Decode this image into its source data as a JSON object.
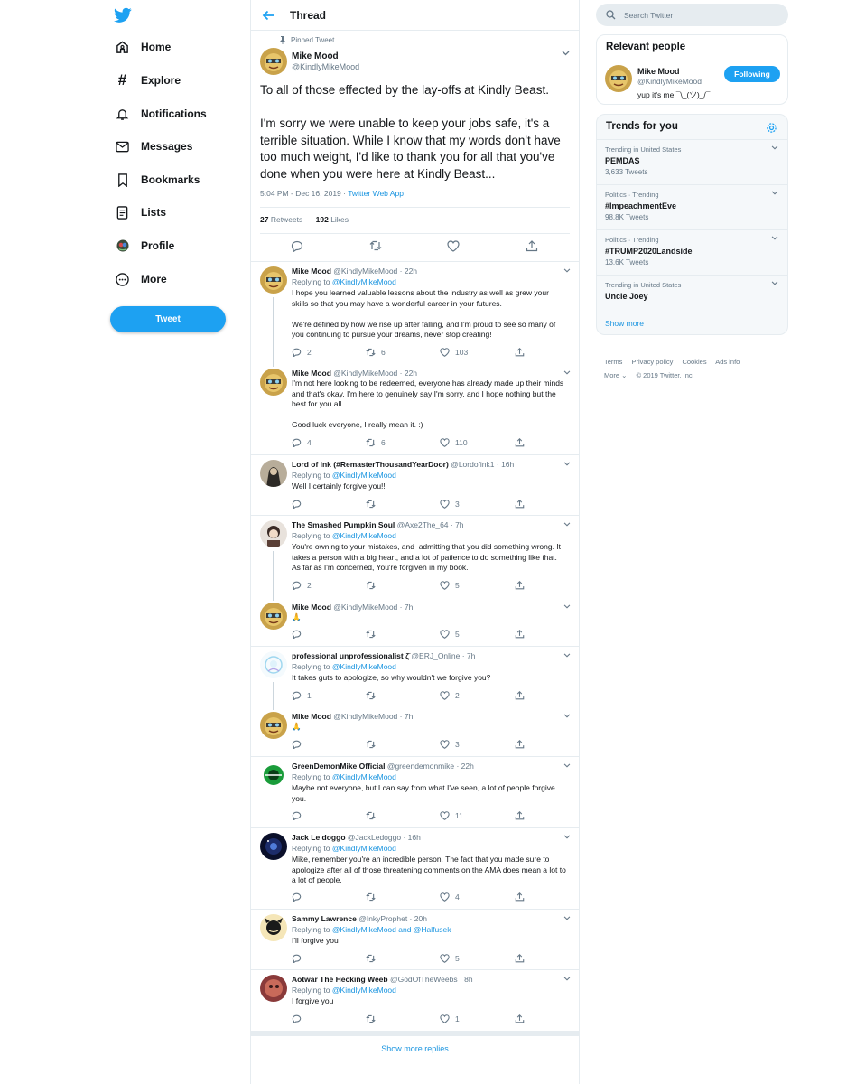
{
  "nav": {
    "items": [
      {
        "label": "Home",
        "icon": "home-icon"
      },
      {
        "label": "Explore",
        "icon": "hashtag-icon"
      },
      {
        "label": "Notifications",
        "icon": "bell-icon"
      },
      {
        "label": "Messages",
        "icon": "envelope-icon"
      },
      {
        "label": "Bookmarks",
        "icon": "bookmark-icon"
      },
      {
        "label": "Lists",
        "icon": "list-icon"
      },
      {
        "label": "Profile",
        "icon": "profile-avatar-icon"
      },
      {
        "label": "More",
        "icon": "more-dots-icon"
      }
    ],
    "tweet_button": "Tweet"
  },
  "header": {
    "title": "Thread"
  },
  "main_tweet": {
    "pinned_label": "Pinned Tweet",
    "name": "Mike Mood",
    "handle": "@KindlyMikeMood",
    "text": "To all of those effected by the lay-offs at Kindly Beast.\n\nI'm sorry we were unable to keep your jobs safe, it's a terrible situation. While I know that my words don't have too much weight, I'd like to thank you for all that you've done when you were here at Kindly Beast...",
    "time": "5:04 PM - Dec 16, 2019 · ",
    "source": "Twitter Web App",
    "retweets": "27",
    "retweets_label": " Retweets",
    "likes": "192",
    "likes_label": " Likes"
  },
  "replies": [
    {
      "name": "Mike Mood",
      "handle": "@KindlyMikeMood · 22h",
      "replying_prefix": "Replying to ",
      "replying_to": "@KindlyMikeMood",
      "text": "I hope you learned valuable lessons about the industry as well as grew your skills so that you may have a wonderful career in your futures.\n\nWe're defined by how we rise up after falling, and I'm proud to see so many of you continuing to pursue your dreams, never stop creating!",
      "replies": "2",
      "retweets": "6",
      "likes": "103"
    },
    {
      "name": "Mike Mood",
      "handle": "@KindlyMikeMood · 22h",
      "text": "I'm not here looking to be redeemed, everyone has already made up their minds and that's okay, I'm here to genuinely say I'm sorry, and I hope nothing but the best for you all.\n\nGood luck everyone, I really mean it. :)",
      "replies": "4",
      "retweets": "6",
      "likes": "110"
    },
    {
      "name": "Lord of ink (#RemasterThousandYearDoor)",
      "handle": "@Lordofink1 · 16h",
      "replying_prefix": "Replying to ",
      "replying_to": "@KindlyMikeMood",
      "text": "Well I certainly forgive you!!",
      "replies": "",
      "retweets": "",
      "likes": "3"
    },
    {
      "name": "The Smashed Pumpkin Soul",
      "handle": "@Axe2The_64 · 7h",
      "replying_prefix": "Replying to ",
      "replying_to": "@KindlyMikeMood",
      "text": "You're owning to your mistakes, and  admitting that you did something wrong. It takes a person with a big heart, and a lot of patience to do something like that. As far as I'm concerned, You're forgiven in my book.",
      "replies": "2",
      "retweets": "",
      "likes": "5"
    },
    {
      "name": "Mike Mood",
      "handle": "@KindlyMikeMood · 7h",
      "text": "🙏",
      "replies": "",
      "retweets": "",
      "likes": "5"
    },
    {
      "name": "professional unprofessionalist ζ̈",
      "handle": "@ERJ_Online · 7h",
      "replying_prefix": "Replying to ",
      "replying_to": "@KindlyMikeMood",
      "text": "It takes guts to apologize, so why wouldn't we forgive you?",
      "replies": "1",
      "retweets": "",
      "likes": "2"
    },
    {
      "name": "Mike Mood",
      "handle": "@KindlyMikeMood · 7h",
      "text": "🙏",
      "replies": "",
      "retweets": "",
      "likes": "3"
    },
    {
      "name": "GreenDemonMike Official",
      "handle": "@greendemonmike · 22h",
      "replying_prefix": "Replying to ",
      "replying_to": "@KindlyMikeMood",
      "text": "Maybe not everyone, but I can say from what I've seen, a lot of people forgive you.",
      "replies": "",
      "retweets": "",
      "likes": "11"
    },
    {
      "name": "Jack Le doggo",
      "handle": "@JackLedoggo · 16h",
      "replying_prefix": "Replying to ",
      "replying_to": "@KindlyMikeMood",
      "text": "Mike, remember you're an incredible person. The fact that you made sure to apologize after all of those threatening comments on the AMA does mean a lot to a lot of people.",
      "replies": "",
      "retweets": "",
      "likes": "4"
    },
    {
      "name": "Sammy Lawrence",
      "handle": "@InkyProphet · 20h",
      "replying_prefix": "Replying to ",
      "replying_to": "@KindlyMikeMood and @Halfusek",
      "text": "I'll forgive you",
      "replies": "",
      "retweets": "",
      "likes": "5"
    },
    {
      "name": "Aotwar The Hecking Weeb",
      "handle": "@GodOfTheWeebs · 8h",
      "replying_prefix": "Replying to ",
      "replying_to": "@KindlyMikeMood",
      "text": "I forgive you",
      "replies": "",
      "retweets": "",
      "likes": "1"
    }
  ],
  "show_more_replies": "Show more replies",
  "search": {
    "placeholder": "Search Twitter"
  },
  "relevant_people": {
    "title": "Relevant people",
    "name": "Mike Mood",
    "handle": "@KindlyMikeMood",
    "bio": "yup it's me ¯\\_(ツ)_/¯",
    "button": "Following"
  },
  "trends": {
    "title": "Trends for you",
    "items": [
      {
        "context": "Trending in United States",
        "name": "PEMDAS",
        "count": "3,633 Tweets"
      },
      {
        "context": "Politics · Trending",
        "name": "#ImpeachmentEve",
        "count": "98.8K Tweets"
      },
      {
        "context": "Politics · Trending",
        "name": "#TRUMP2020Landside",
        "count": "13.6K Tweets"
      },
      {
        "context": "Trending in United States",
        "name": "Uncle Joey",
        "count": ""
      }
    ],
    "show_more": "Show more"
  },
  "footer": {
    "links": [
      "Terms",
      "Privacy policy",
      "Cookies",
      "Ads info"
    ],
    "more": "More ⌄",
    "copyright": "© 2019 Twitter, Inc."
  },
  "colors": {
    "accent": "#1da1f2",
    "link": "#1b95e0",
    "muted": "#657786",
    "border": "#e6ecf0"
  }
}
